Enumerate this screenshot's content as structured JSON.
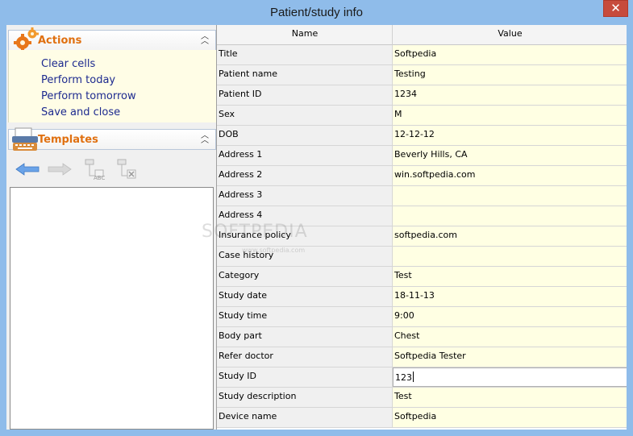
{
  "window": {
    "title": "Patient/study info",
    "close_label": "✕"
  },
  "actions": {
    "title": "Actions",
    "items": [
      {
        "label": "Clear cells"
      },
      {
        "label": "Perform today"
      },
      {
        "label": "Perform tomorrow"
      },
      {
        "label": "Save and close"
      }
    ]
  },
  "templates": {
    "title": "Templates"
  },
  "grid": {
    "col_name": "Name",
    "col_value": "Value",
    "rows": [
      {
        "name": "Title",
        "value": "Softpedia"
      },
      {
        "name": "Patient name",
        "value": "Testing"
      },
      {
        "name": "Patient ID",
        "value": "1234"
      },
      {
        "name": "Sex",
        "value": "M"
      },
      {
        "name": "DOB",
        "value": "12-12-12"
      },
      {
        "name": "Address 1",
        "value": "Beverly Hills, CA"
      },
      {
        "name": "Address 2",
        "value": "win.softpedia.com"
      },
      {
        "name": "Address 3",
        "value": ""
      },
      {
        "name": "Address 4",
        "value": ""
      },
      {
        "name": "Insurance policy",
        "value": "softpedia.com"
      },
      {
        "name": "Case history",
        "value": ""
      },
      {
        "name": "Category",
        "value": "Test"
      },
      {
        "name": "Study date",
        "value": "18-11-13"
      },
      {
        "name": "Study time",
        "value": "9:00"
      },
      {
        "name": "Body part",
        "value": "Chest"
      },
      {
        "name": "Refer doctor",
        "value": "Softpedia Tester"
      },
      {
        "name": "Study ID",
        "value": "123"
      },
      {
        "name": "Study description",
        "value": "Test"
      },
      {
        "name": "Device name",
        "value": "Softpedia"
      }
    ]
  },
  "watermark": {
    "text": "SOFTPEDIA",
    "sub": "www.softpedia.com"
  }
}
